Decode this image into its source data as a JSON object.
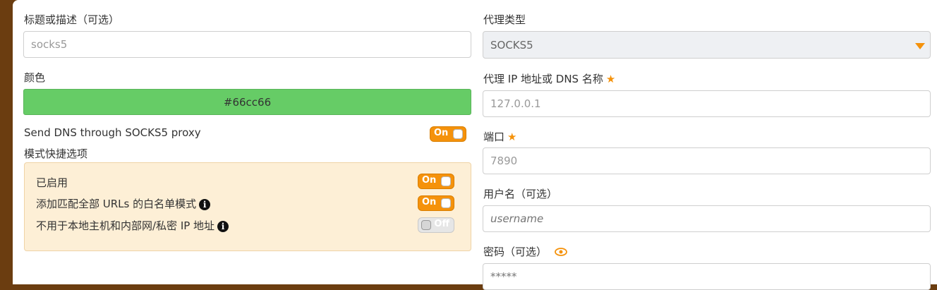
{
  "left": {
    "title_label": "标题或描述（可选）",
    "title_value": "socks5",
    "color_label": "颜色",
    "color_value": "#66cc66",
    "dns_label": "Send DNS through SOCKS5 proxy",
    "dns_toggle": "On",
    "quick_label": "模式快捷选项",
    "quick_options": [
      {
        "label": "已启用",
        "toggle": "On"
      },
      {
        "label": "添加匹配全部 URLs 的白名单模式",
        "toggle": "On"
      },
      {
        "label": "不用于本地主机和内部网/私密 IP 地址",
        "toggle": "Off"
      }
    ]
  },
  "right": {
    "proxy_type_label": "代理类型",
    "proxy_type_value": "SOCKS5",
    "address_label": "代理 IP 地址或 DNS 名称",
    "address_value": "127.0.0.1",
    "port_label": "端口",
    "port_value": "7890",
    "username_label": "用户名（可选）",
    "username_placeholder": "username",
    "password_label": "密码（可选）",
    "password_placeholder": "*****"
  },
  "colors": {
    "accent": "#f5920b",
    "color_swatch": "#66cc66",
    "quick_box_bg": "#fdefd6",
    "sidebar": "#6b3d10"
  },
  "icons": {
    "required": "star-icon",
    "info": "info-icon",
    "dropdown": "chevron-down-icon",
    "reveal": "eye-icon"
  }
}
